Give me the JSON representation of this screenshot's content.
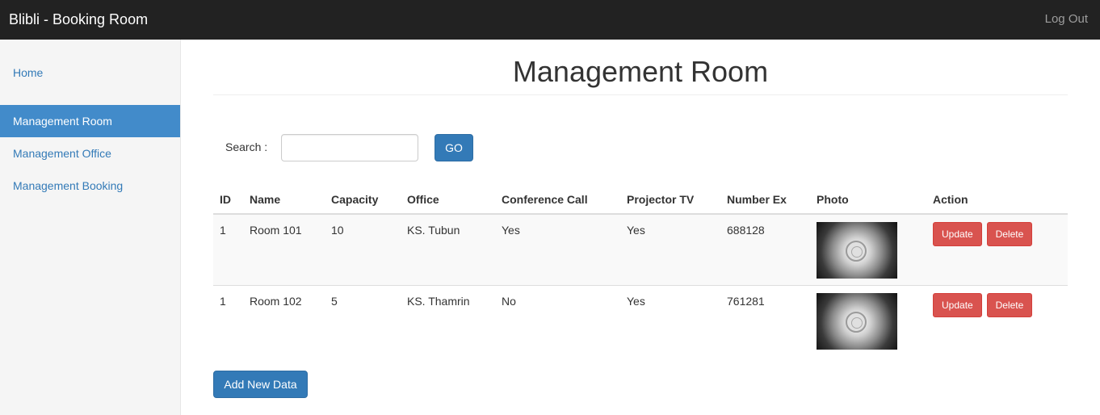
{
  "navbar": {
    "brand": "Blibli - Booking Room",
    "logout": "Log Out"
  },
  "sidebar": {
    "items": [
      {
        "label": "Home"
      },
      {
        "label": "Management Room"
      },
      {
        "label": "Management Office"
      },
      {
        "label": "Management Booking"
      }
    ],
    "active": "Management Room"
  },
  "main": {
    "title": "Management Room",
    "search": {
      "label": "Search :",
      "value": "",
      "placeholder": "",
      "button": "GO"
    },
    "table": {
      "columns": [
        "ID",
        "Name",
        "Capacity",
        "Office",
        "Conference Call",
        "Projector TV",
        "Number Ex",
        "Photo",
        "Action"
      ],
      "rows": [
        {
          "id": "1",
          "name": "Room 101",
          "capacity": "10",
          "office": "KS. Tubun",
          "conference_call": "Yes",
          "projector_tv": "Yes",
          "number_ex": "688128",
          "update": "Update",
          "delete": "Delete"
        },
        {
          "id": "1",
          "name": "Room 102",
          "capacity": "5",
          "office": "KS. Thamrin",
          "conference_call": "No",
          "projector_tv": "Yes",
          "number_ex": "761281",
          "update": "Update",
          "delete": "Delete"
        }
      ]
    },
    "add_button": "Add New Data"
  },
  "colors": {
    "navbar": "#222222",
    "primary": "#337ab7",
    "active_nav": "#428bca",
    "danger": "#d9534f"
  }
}
